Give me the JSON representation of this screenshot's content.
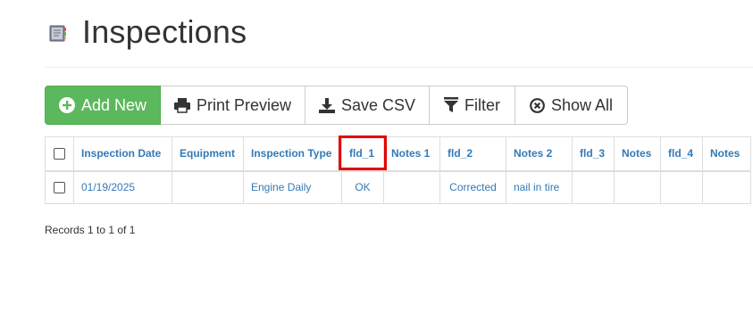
{
  "page": {
    "title": "Inspections"
  },
  "toolbar": {
    "add_new": "Add New",
    "print_preview": "Print Preview",
    "save_csv": "Save CSV",
    "filter": "Filter",
    "show_all": "Show All"
  },
  "table": {
    "columns": [
      "Inspection Date",
      "Equipment",
      "Inspection Type",
      "fld_1",
      "Notes 1",
      "fld_2",
      "Notes 2",
      "fld_3",
      "Notes",
      "fld_4",
      "Notes"
    ],
    "rows": [
      [
        "01/19/2025",
        "",
        "Engine Daily",
        "OK",
        "",
        "Corrected",
        "nail in tire",
        "",
        "",
        "",
        ""
      ]
    ]
  },
  "footer": {
    "records": "Records 1 to 1 of 1"
  },
  "colors": {
    "accent": "#337ab7",
    "success": "#5cb85c",
    "highlight": "#e30000"
  }
}
